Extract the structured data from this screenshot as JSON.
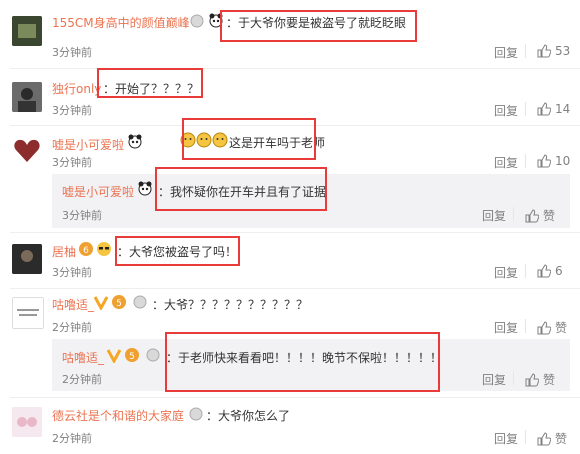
{
  "comments": [
    {
      "user": "155CM身高中的颜值巅峰",
      "text": "：于大爷你要是被盗号了就眨眨眼",
      "time": "3分钟前",
      "reply_label": "回复",
      "likes": "53"
    },
    {
      "user": "独行only",
      "text": "：开始了？？？？",
      "time": "3分钟前",
      "reply_label": "回复",
      "likes": "14"
    },
    {
      "user": "嘘是小可爱啦",
      "text": "这是开车吗于老师",
      "time": "3分钟前",
      "reply_label": "回复",
      "likes": "10",
      "sub": {
        "user": "嘘是小可爱啦",
        "text": "：我怀疑你在开车并且有了证据",
        "time": "3分钟前",
        "reply_label": "回复",
        "like_label": "赞"
      }
    },
    {
      "user": "居柚",
      "text": "：大爷您被盗号了吗！",
      "time": "3分钟前",
      "reply_label": "回复",
      "likes": "6"
    },
    {
      "user": "咕噜适_",
      "text": "：大爷？？？？？？？？？？",
      "time": "2分钟前",
      "reply_label": "回复",
      "like_label": "赞",
      "sub": {
        "user": "咕噜适_",
        "text": "：于老师快来看看吧！！！！晚节不保啦！！！！！",
        "time": "2分钟前",
        "reply_label": "回复",
        "like_label": "赞"
      }
    },
    {
      "user": "德云社是个和谐的大家庭",
      "text": "：大爷你怎么了",
      "time": "2分钟前",
      "reply_label": "回复",
      "like_label": "赞"
    }
  ],
  "colors": {
    "username": "#eb7350",
    "highlight": "#ea3b3b",
    "meta": "#808080"
  }
}
